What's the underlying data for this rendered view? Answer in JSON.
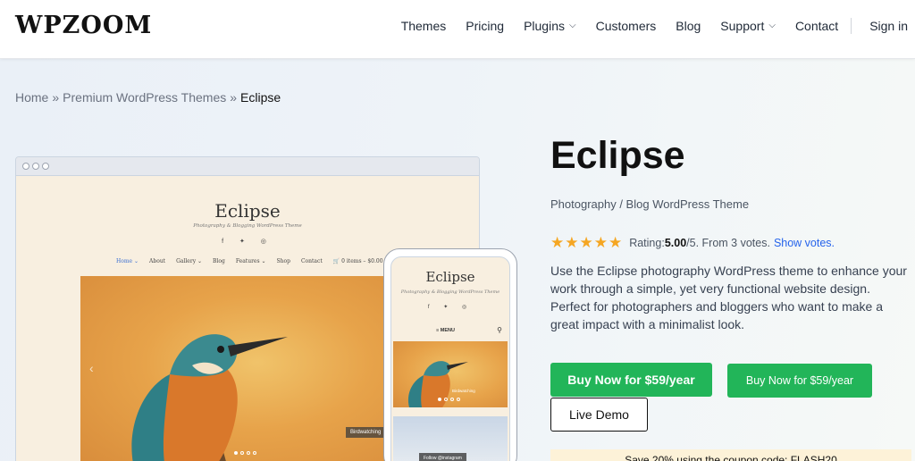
{
  "header": {
    "logo": "WPZOOM",
    "nav": [
      {
        "label": "Themes",
        "dropdown": false
      },
      {
        "label": "Pricing",
        "dropdown": false
      },
      {
        "label": "Plugins",
        "dropdown": true
      },
      {
        "label": "Customers",
        "dropdown": false
      },
      {
        "label": "Blog",
        "dropdown": false
      },
      {
        "label": "Support",
        "dropdown": true
      },
      {
        "label": "Contact",
        "dropdown": false
      }
    ],
    "sign_in": "Sign in"
  },
  "breadcrumb": {
    "home": "Home",
    "separator": "»",
    "parent": "Premium WordPress Themes",
    "current": "Eclipse"
  },
  "preview": {
    "desktop": {
      "title": "Eclipse",
      "tagline": "Photography & Blogging WordPress Theme",
      "social": "f ✦ ◎",
      "menu": [
        "Home ⌄",
        "About",
        "Gallery ⌄",
        "Blog",
        "Features ⌄",
        "Shop",
        "Contact",
        "🛒 0 items – $0.00"
      ],
      "caption": "Birdwatching"
    },
    "phone": {
      "title": "Eclipse",
      "tagline": "Photography & Blogging WordPress Theme",
      "social": "f ✦ ◎",
      "menu": "≡ MENU",
      "caption": "Birdwatching",
      "follow": "Follow @instagram"
    }
  },
  "product": {
    "title": "Eclipse",
    "subtitle": "Photography / Blog WordPress Theme",
    "rating": {
      "stars": 5,
      "prefix": "Rating: ",
      "score": "5.00",
      "suffix": "/5. From 3 votes.",
      "show_votes": "Show votes."
    },
    "description": "Use the Eclipse photography WordPress theme to enhance your work through a simple, yet very functional website design. Perfect for photographers and bloggers who want to make a great impact with a minimalist look.",
    "buy_primary": "Buy Now for $59/year",
    "buy_secondary": "Buy Now for $59/year",
    "live_demo": "Live Demo",
    "coupon": "Save 20% using the coupon code: FLASH20"
  },
  "colors": {
    "accent_green": "#22b559",
    "star": "#f5a623",
    "link": "#2563eb"
  }
}
